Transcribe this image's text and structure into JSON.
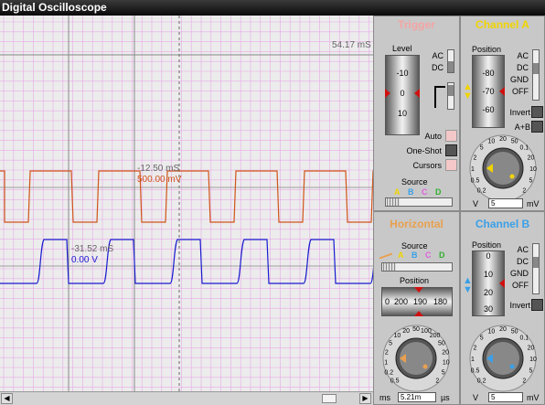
{
  "window": {
    "title": "Digital Oscilloscope"
  },
  "scope": {
    "time_marker_top": "54.17 mS",
    "cursor_a_time": "-12.50 mS",
    "cursor_a_volts": "500.00 mV",
    "cursor_b_time": "-31.52 mS",
    "cursor_b_volts": "0.00 V",
    "colors": {
      "grid": "#e8a8e8",
      "channel_a": "#d0541a",
      "channel_b": "#1a1ad0",
      "background": "#ececec"
    }
  },
  "trigger": {
    "title": "Trigger",
    "level_label": "Level",
    "level_ticks": [
      "-10",
      "0",
      "10"
    ],
    "coupling": [
      "AC",
      "DC"
    ],
    "modes": [
      "Auto",
      "One-Shot",
      "Cursors"
    ],
    "source_label": "Source",
    "sources": [
      "A",
      "B",
      "C",
      "D"
    ],
    "title_color": "#f4a4a4"
  },
  "channel_a": {
    "title": "Channel A",
    "position_label": "Position",
    "position_ticks": [
      "-80",
      "-70",
      "-60"
    ],
    "coupling": [
      "AC",
      "DC",
      "GND",
      "OFF"
    ],
    "invert_label": "Invert",
    "sum_label": "A+B",
    "dial_ticks": [
      "0.2",
      "0.5",
      "1",
      "2",
      "5",
      "10",
      "20",
      "50",
      "0.1",
      "20",
      "10",
      "5",
      "2"
    ],
    "volts_unit_left": "V",
    "volts_value": "5",
    "volts_unit_right": "mV",
    "title_color": "#f0d400"
  },
  "horizontal": {
    "title": "Horizontal",
    "source_label": "Source",
    "sources": [
      "A",
      "B",
      "C",
      "D"
    ],
    "position_label": "Position",
    "position_ticks": [
      "200",
      "190",
      "180"
    ],
    "position_left_tick": "0",
    "dial_ticks": [
      "0.5",
      "0.2",
      "1",
      "2",
      "5",
      "10",
      "20",
      "50",
      "100",
      "200",
      "50",
      "20",
      "10",
      "5",
      "2"
    ],
    "units_left": "ms",
    "time_value": "5.21m",
    "units_right": "µs",
    "title_color": "#e8a050"
  },
  "channel_b": {
    "title": "Channel B",
    "position_label": "Position",
    "position_ticks": [
      "0",
      "10",
      "20",
      "30"
    ],
    "coupling": [
      "AC",
      "DC",
      "GND",
      "OFF"
    ],
    "invert_label": "Invert",
    "dial_ticks": [
      "0.2",
      "0.5",
      "1",
      "2",
      "5",
      "10",
      "20",
      "50",
      "0.1",
      "20",
      "10",
      "5",
      "2"
    ],
    "volts_unit_left": "V",
    "volts_value": "5",
    "volts_unit_right": "mV",
    "title_color": "#3aa0e8"
  }
}
